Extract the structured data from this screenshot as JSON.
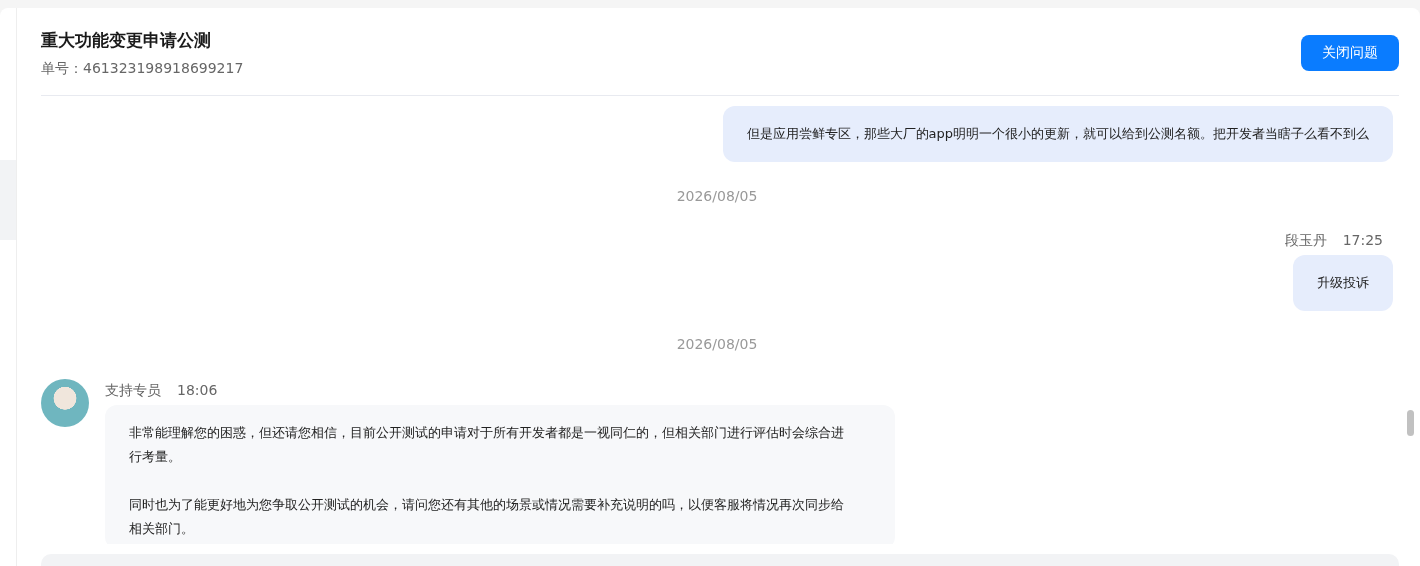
{
  "header": {
    "title": "重大功能变更申请公测",
    "ticket_label": "单号：461323198918699217",
    "close_button": "关闭问题"
  },
  "messages": [
    {
      "kind": "sent",
      "paragraphs": [
        "但是应用尝鲜专区，那些大厂的app明明一个很小的更新，就可以给到公测名额。把开发者当瞎子么看不到么"
      ]
    },
    {
      "kind": "date",
      "text": "2026/08/05"
    },
    {
      "kind": "sent",
      "sender": "段玉丹",
      "time": "17:25",
      "paragraphs": [
        "升级投诉"
      ]
    },
    {
      "kind": "date",
      "text": "2026/08/05"
    },
    {
      "kind": "received",
      "sender": "支持专员",
      "time": "18:06",
      "paragraphs": [
        "非常能理解您的困惑，但还请您相信，目前公开测试的申请对于所有开发者都是一视同仁的，但相关部门进行评估时会综合进行考量。",
        "同时也为了能更好地为您争取公开测试的机会，请问您还有其他的场景或情况需要补充说明的吗，以便客服将情况再次同步给相关部门。"
      ]
    }
  ]
}
